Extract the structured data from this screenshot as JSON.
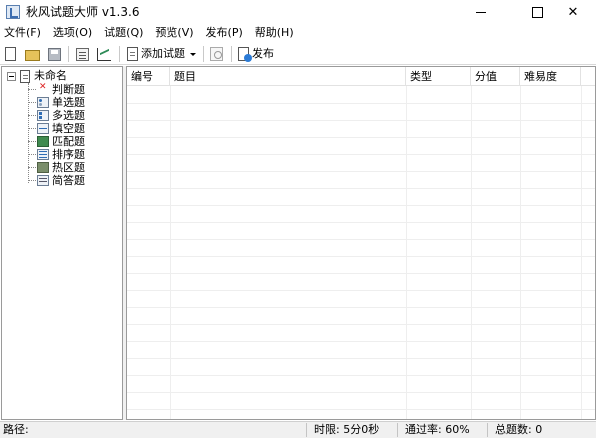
{
  "window": {
    "title": "秋风试题大师 v1.3.6",
    "close_glyph": "✕"
  },
  "menu": [
    {
      "label": "文件(F)"
    },
    {
      "label": "选项(O)"
    },
    {
      "label": "试题(Q)"
    },
    {
      "label": "预览(V)"
    },
    {
      "label": "发布(P)"
    },
    {
      "label": "帮助(H)"
    }
  ],
  "toolbar": {
    "add_question_label": "添加试题",
    "publish_label": "发布"
  },
  "tree": {
    "root_label": "未命名",
    "items": [
      {
        "label": "判断题",
        "icon": "judge-icon"
      },
      {
        "label": "单选题",
        "icon": "single-choice-icon"
      },
      {
        "label": "多选题",
        "icon": "multi-choice-icon"
      },
      {
        "label": "填空题",
        "icon": "fill-blank-icon"
      },
      {
        "label": "匹配题",
        "icon": "matching-icon"
      },
      {
        "label": "排序题",
        "icon": "ordering-icon"
      },
      {
        "label": "热区题",
        "icon": "hotspot-icon"
      },
      {
        "label": "简答题",
        "icon": "short-answer-icon"
      }
    ]
  },
  "list": {
    "columns": [
      {
        "label": "编号"
      },
      {
        "label": "题目"
      },
      {
        "label": "类型"
      },
      {
        "label": "分值"
      },
      {
        "label": "难易度"
      }
    ],
    "rows": []
  },
  "status": {
    "path_label": "路径:",
    "time_limit": "时限: 5分0秒",
    "pass_rate": "通过率: 60%",
    "total_questions": "总题数: 0"
  }
}
